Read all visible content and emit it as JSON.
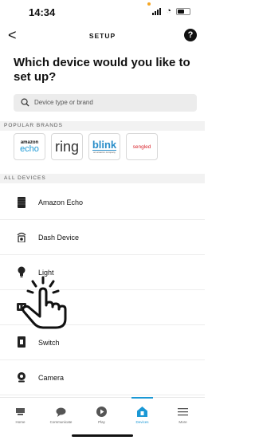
{
  "status_bar": {
    "time": "14:34"
  },
  "header": {
    "back_glyph": "<",
    "title": "SETUP",
    "help_glyph": "?"
  },
  "heading": "Which device would you like to set up?",
  "search": {
    "placeholder": "Device type or brand",
    "icon": "search-icon"
  },
  "popular_brands": {
    "label": "POPULAR BRANDS",
    "brands": [
      {
        "name": "amazon echo",
        "amazon": "amazon",
        "echo": "echo"
      },
      {
        "name": "ring",
        "text": "ring"
      },
      {
        "name": "blink",
        "text": "blink",
        "sub": "an amazon company"
      },
      {
        "name": "sengled",
        "text": "sengled"
      }
    ]
  },
  "all_devices": {
    "label": "ALL DEVICES",
    "items": [
      {
        "label": "Amazon Echo",
        "icon": "echo-speaker-icon"
      },
      {
        "label": "Dash Device",
        "icon": "dash-device-icon"
      },
      {
        "label": "Light",
        "icon": "light-bulb-icon"
      },
      {
        "label": "",
        "icon": "plug-icon"
      },
      {
        "label": "Switch",
        "icon": "switch-icon"
      },
      {
        "label": "Camera",
        "icon": "camera-icon"
      }
    ]
  },
  "tabbar": {
    "tabs": [
      {
        "label": "Home",
        "icon": "home-icon",
        "active": false
      },
      {
        "label": "Communicate",
        "icon": "chat-icon",
        "active": false
      },
      {
        "label": "Play",
        "icon": "play-icon",
        "active": false
      },
      {
        "label": "Devices",
        "icon": "devices-icon",
        "active": true
      },
      {
        "label": "More",
        "icon": "menu-icon",
        "active": false
      }
    ]
  },
  "colors": {
    "accent": "#1a98d5",
    "sengled": "#d9262e",
    "blink": "#2a8ec9"
  }
}
